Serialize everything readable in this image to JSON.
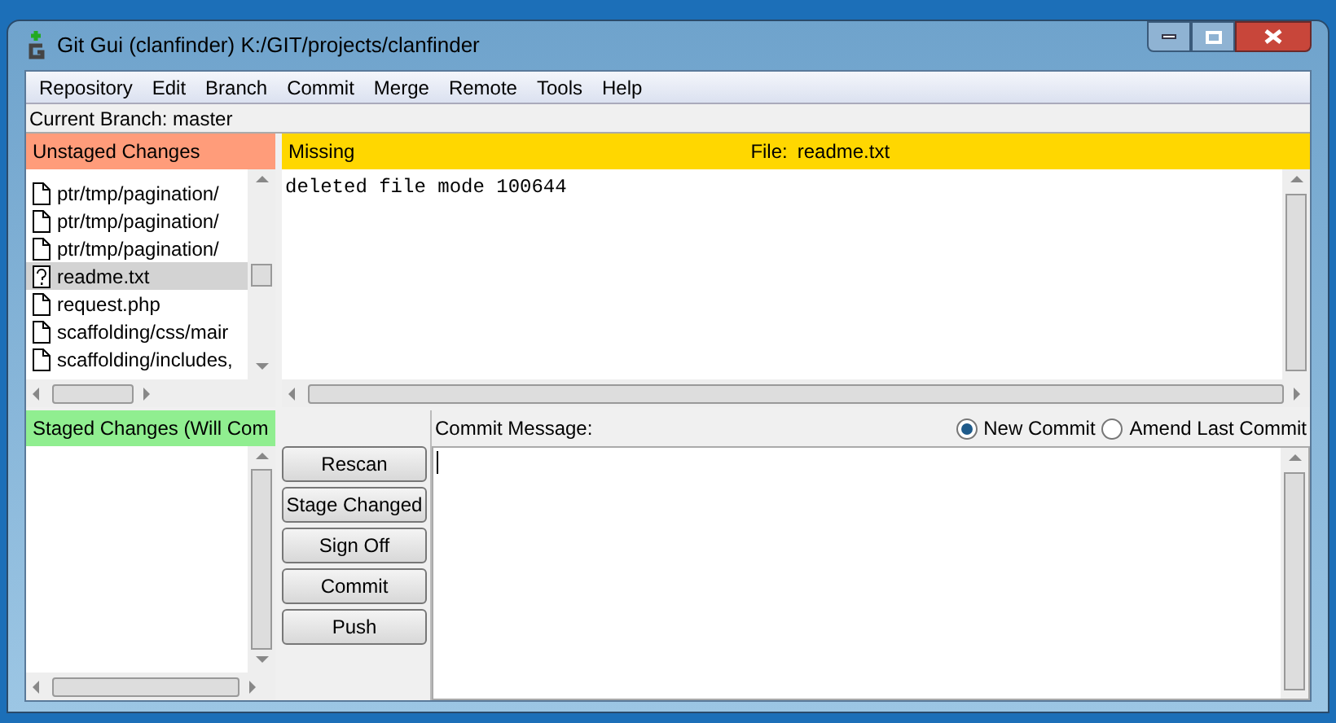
{
  "window": {
    "title": "Git Gui (clanfinder) K:/GIT/projects/clanfinder"
  },
  "menu": [
    "Repository",
    "Edit",
    "Branch",
    "Commit",
    "Merge",
    "Remote",
    "Tools",
    "Help"
  ],
  "current_branch": "Current Branch: master",
  "unstaged": {
    "title": "Unstaged Changes",
    "files": [
      {
        "name": "ptr/tmp/pagination/",
        "kind": "file",
        "selected": false
      },
      {
        "name": "ptr/tmp/pagination/",
        "kind": "file",
        "selected": false
      },
      {
        "name": "ptr/tmp/pagination/",
        "kind": "file",
        "selected": false
      },
      {
        "name": "readme.txt",
        "kind": "unknown",
        "selected": true
      },
      {
        "name": "request.php",
        "kind": "file",
        "selected": false
      },
      {
        "name": "scaffolding/css/mair",
        "kind": "file",
        "selected": false
      },
      {
        "name": "scaffolding/includes,",
        "kind": "file",
        "selected": false
      }
    ]
  },
  "staged": {
    "title": "Staged Changes (Will Com"
  },
  "diff": {
    "status": "Missing",
    "file_label": "File:",
    "file": "readme.txt",
    "lines": [
      "deleted file mode 100644"
    ]
  },
  "buttons": [
    "Rescan",
    "Stage Changed",
    "Sign Off",
    "Commit",
    "Push"
  ],
  "commit": {
    "label": "Commit Message:",
    "modes": [
      {
        "label": "New Commit",
        "selected": true
      },
      {
        "label": "Amend Last Commit",
        "selected": false
      }
    ]
  }
}
